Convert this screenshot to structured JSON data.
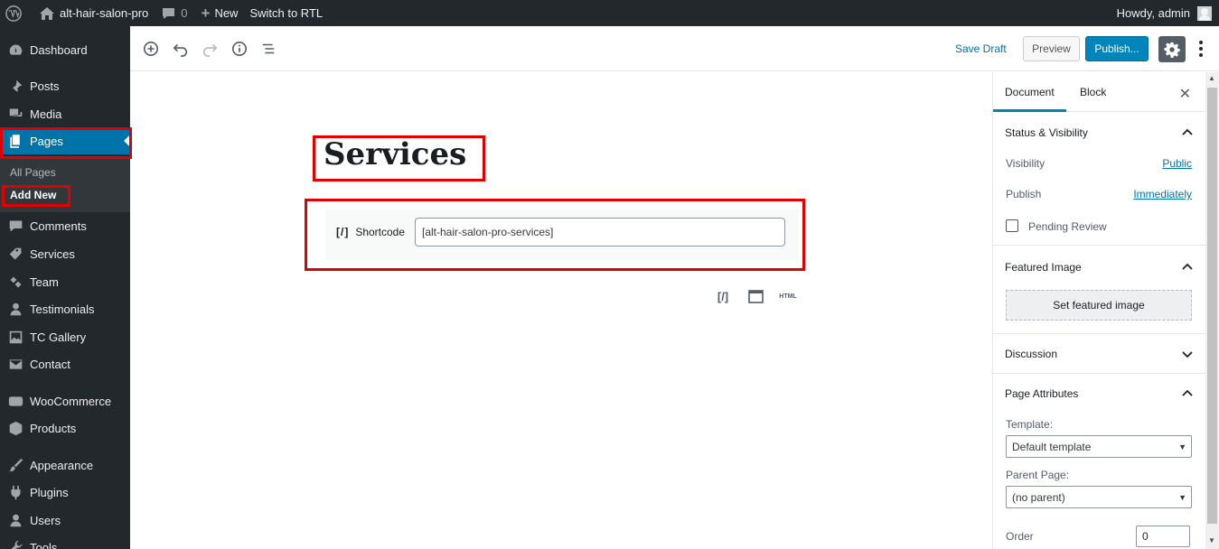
{
  "adminbar": {
    "site_name": "alt-hair-salon-pro",
    "comments_count": "0",
    "new_label": "New",
    "rtl_label": "Switch to RTL",
    "howdy": "Howdy, admin"
  },
  "sidebar": {
    "items": [
      {
        "label": "Dashboard",
        "icon": "dashboard-icon"
      },
      {
        "label": "Posts",
        "icon": "pin-icon"
      },
      {
        "label": "Media",
        "icon": "media-icon"
      },
      {
        "label": "Pages",
        "icon": "pages-icon"
      },
      {
        "label": "Comments",
        "icon": "comment-icon"
      },
      {
        "label": "Services",
        "icon": "tag-icon"
      },
      {
        "label": "Team",
        "icon": "team-icon"
      },
      {
        "label": "Testimonials",
        "icon": "user-icon"
      },
      {
        "label": "TC Gallery",
        "icon": "gallery-icon"
      },
      {
        "label": "Contact",
        "icon": "mail-icon"
      },
      {
        "label": "WooCommerce",
        "icon": "woo-icon"
      },
      {
        "label": "Products",
        "icon": "box-icon"
      },
      {
        "label": "Appearance",
        "icon": "brush-icon"
      },
      {
        "label": "Plugins",
        "icon": "plugin-icon"
      },
      {
        "label": "Users",
        "icon": "users-icon"
      },
      {
        "label": "Tools",
        "icon": "wrench-icon"
      }
    ],
    "submenu": {
      "all_pages": "All Pages",
      "add_new": "Add New"
    }
  },
  "header": {
    "save_draft": "Save Draft",
    "preview": "Preview",
    "publish": "Publish..."
  },
  "editor": {
    "title": "Services",
    "shortcode_brackets": "[/]",
    "shortcode_label": "Shortcode",
    "shortcode_value": "[alt-hair-salon-pro-services]",
    "inserter_html": "HTML",
    "inserter_shortcode": "[/]"
  },
  "panel": {
    "tab_document": "Document",
    "tab_block": "Block",
    "status_title": "Status & Visibility",
    "visibility_label": "Visibility",
    "visibility_value": "Public",
    "publish_label": "Publish",
    "publish_value": "Immediately",
    "pending_review": "Pending Review",
    "featured_title": "Featured Image",
    "set_featured": "Set featured image",
    "discussion_title": "Discussion",
    "attributes_title": "Page Attributes",
    "template_label": "Template:",
    "template_value": "Default template",
    "parent_label": "Parent Page:",
    "parent_value": "(no parent)",
    "order_label": "Order",
    "order_value": "0"
  },
  "colors": {
    "admin_dark": "#23282d",
    "accent_blue": "#0073aa",
    "publish_blue": "#0085ba",
    "highlight_red": "#e00000"
  }
}
